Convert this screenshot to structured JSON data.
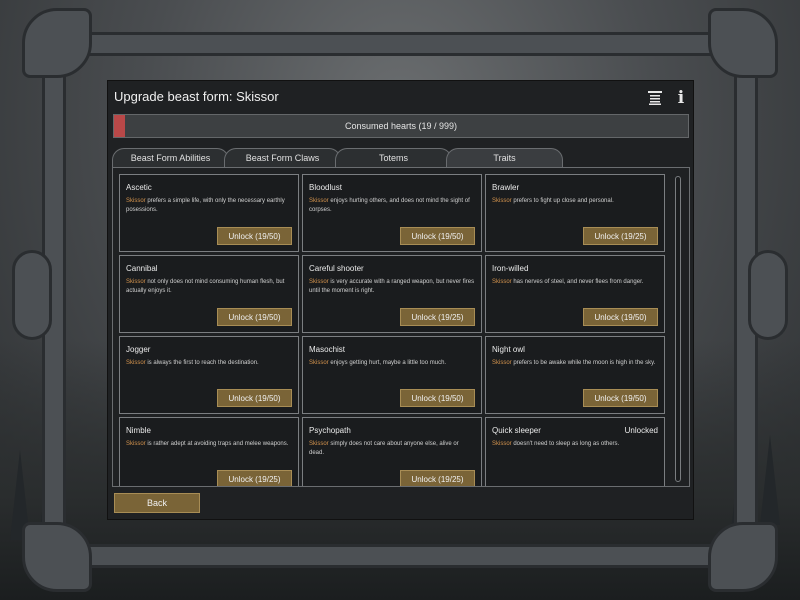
{
  "window": {
    "title": "Upgrade beast form: Skissor"
  },
  "icons": {
    "list": "list-icon",
    "info": "info-icon"
  },
  "progress": {
    "label": "Consumed hearts (19 / 999)",
    "current": 19,
    "max": 999,
    "fill_color": "#b94848"
  },
  "tabs": [
    {
      "label": "Beast Form Abilities"
    },
    {
      "label": "Beast Form Claws"
    },
    {
      "label": "Totems"
    },
    {
      "label": "Traits"
    }
  ],
  "traits": [
    {
      "title": "Ascetic",
      "name": "Skissor",
      "desc": " prefers a simple life, with only the necessary earthly posessions.",
      "button": "Unlock (19/50)"
    },
    {
      "title": "Bloodlust",
      "name": "Skissor",
      "desc": " enjoys hurting others, and does not mind the sight of corpses.",
      "button": "Unlock (19/50)"
    },
    {
      "title": "Brawler",
      "name": "Skissor",
      "desc": " prefers to fight up close and personal.",
      "button": "Unlock (19/25)"
    },
    {
      "title": "Cannibal",
      "name": "Skissor",
      "desc": " not only does not mind consuming human flesh, but actually enjoys it.",
      "button": "Unlock (19/50)"
    },
    {
      "title": "Careful shooter",
      "name": "Skissor",
      "desc": " is very accurate with a ranged weapon, but never fires until the moment is right.",
      "button": "Unlock (19/25)"
    },
    {
      "title": "Iron-willed",
      "name": "Skissor",
      "desc": " has nerves of steel, and never flees from danger.",
      "button": "Unlock (19/50)"
    },
    {
      "title": "Jogger",
      "name": "Skissor",
      "desc": " is always the first to reach the destination.",
      "button": "Unlock (19/50)"
    },
    {
      "title": "Masochist",
      "name": "Skissor",
      "desc": " enjoys getting hurt, maybe a little too much.",
      "button": "Unlock (19/50)"
    },
    {
      "title": "Night owl",
      "name": "Skissor",
      "desc": " prefers to be awake while the moon is high in the sky.",
      "button": "Unlock (19/50)"
    },
    {
      "title": "Nimble",
      "name": "Skissor",
      "desc": " is rather adept at avoiding traps and melee weapons.",
      "button": "Unlock (19/25)"
    },
    {
      "title": "Psychopath",
      "name": "Skissor",
      "desc": " simply does not care about anyone else, alive or dead.",
      "button": "Unlock (19/25)"
    },
    {
      "title": "Quick sleeper",
      "name": "Skissor",
      "desc": " doesn't need to sleep as long as others.",
      "status": "Unlocked"
    }
  ],
  "back_label": "Back",
  "colors": {
    "accent_button": "#7a6437",
    "pawn_name": "#d2924d",
    "progress_fill": "#b94848"
  }
}
